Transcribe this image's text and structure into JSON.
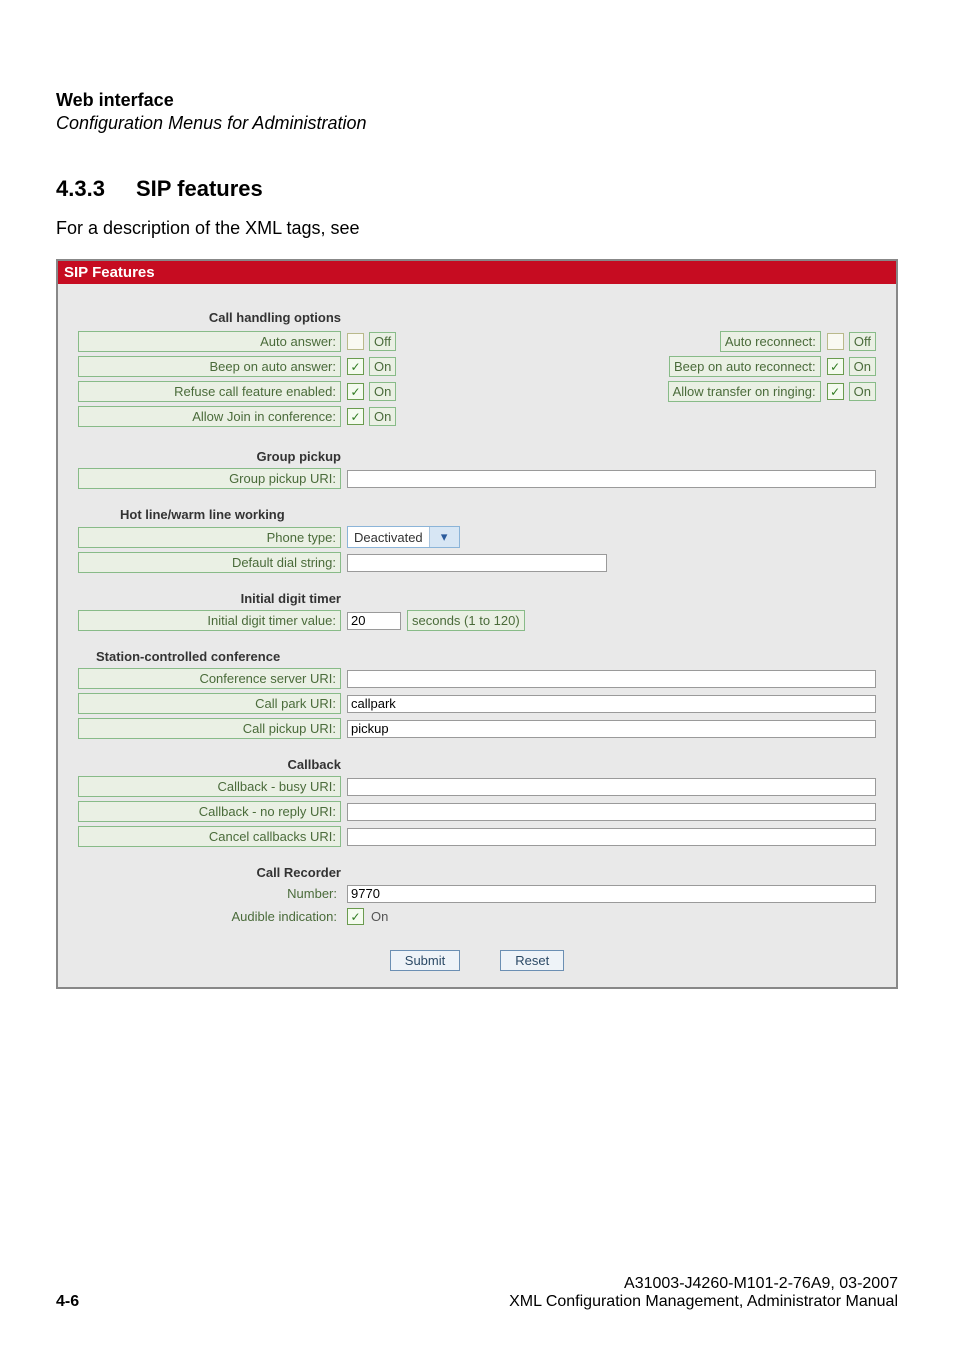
{
  "header": {
    "title": "Web interface",
    "subtitle": "Configuration Menus for Administration"
  },
  "section": {
    "number": "4.3.3",
    "title": "SIP features",
    "description": "For a description of the XML tags, see"
  },
  "panel": {
    "title": "SIP Features",
    "call_handling": {
      "heading": "Call handling options",
      "left": [
        {
          "label": "Auto answer:",
          "checked": false,
          "state": "Off"
        },
        {
          "label": "Beep on auto answer:",
          "checked": true,
          "state": "On"
        },
        {
          "label": "Refuse call feature enabled:",
          "checked": true,
          "state": "On"
        },
        {
          "label": "Allow Join in conference:",
          "checked": true,
          "state": "On"
        }
      ],
      "right": [
        {
          "label": "Auto reconnect:",
          "checked": false,
          "state": "Off"
        },
        {
          "label": "Beep on auto reconnect:",
          "checked": true,
          "state": "On"
        },
        {
          "label": "Allow transfer on ringing:",
          "checked": true,
          "state": "On"
        }
      ]
    },
    "group_pickup": {
      "heading": "Group pickup",
      "uri_label": "Group pickup URI:",
      "uri_value": ""
    },
    "hotline": {
      "heading": "Hot line/warm line working",
      "phone_type_label": "Phone type:",
      "phone_type_value": "Deactivated",
      "default_dial_label": "Default dial string:",
      "default_dial_value": ""
    },
    "initial_digit": {
      "heading": "Initial digit timer",
      "label": "Initial digit timer value:",
      "value": "20",
      "hint": "seconds (1 to 120)"
    },
    "conference": {
      "heading": "Station-controlled conference",
      "server_label": "Conference server URI:",
      "server_value": "",
      "park_label": "Call park URI:",
      "park_value": "callpark",
      "pickup_label": "Call pickup URI:",
      "pickup_value": "pickup"
    },
    "callback": {
      "heading": "Callback",
      "busy_label": "Callback - busy URI:",
      "busy_value": "",
      "noreply_label": "Callback - no reply URI:",
      "noreply_value": "",
      "cancel_label": "Cancel callbacks URI:",
      "cancel_value": ""
    },
    "recorder": {
      "heading": "Call Recorder",
      "number_label": "Number:",
      "number_value": "9770",
      "audible_label": "Audible indication:",
      "audible_checked": true,
      "audible_state": "On"
    },
    "buttons": {
      "submit": "Submit",
      "reset": "Reset"
    }
  },
  "footer": {
    "page": "4-6",
    "doc_id": "A31003-J4260-M101-2-76A9, 03-2007",
    "doc_title": "XML Configuration Management, Administrator Manual"
  }
}
